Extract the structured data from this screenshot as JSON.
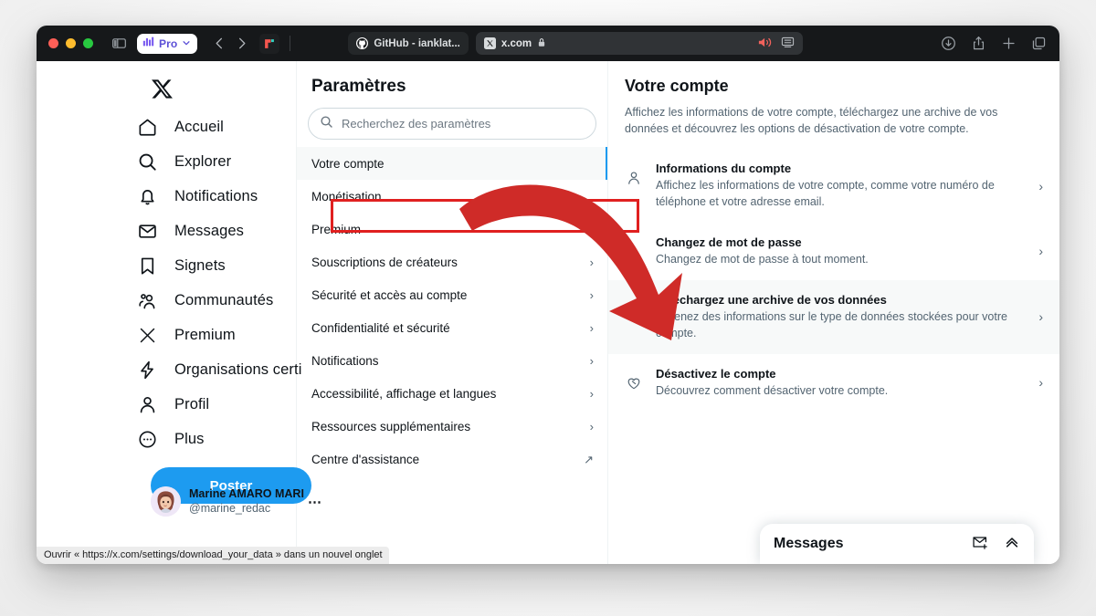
{
  "browser": {
    "traffic_lights": [
      "close",
      "minimize",
      "zoom"
    ],
    "sidebar_toggle_icon": "sidebar-toggle-icon",
    "pro_badge": {
      "label": "Pro",
      "icon": "bar-chart-icon",
      "chevron": "chevron-down-icon",
      "color": "#5b4fd6"
    },
    "nav_back_icon": "chevron-left-icon",
    "nav_forward_icon": "chevron-right-icon",
    "extension_icon": "red-app-icon",
    "tabs": [
      {
        "title": "GitHub - ianklat...",
        "favicon": "github-icon",
        "active": false
      },
      {
        "title": "x.com",
        "favicon": "x-favicon-icon",
        "lock": "lock-icon",
        "active": true,
        "trailing_icons": [
          "audio-playing-icon",
          "picture-in-picture-icon"
        ]
      }
    ],
    "toolbar_right_icons": [
      "downloads-icon",
      "share-icon",
      "new-tab-icon",
      "tab-overview-icon"
    ],
    "titlebar_color": "#16181a"
  },
  "sidebar": {
    "logo": "x-logo-icon",
    "items": [
      {
        "label": "Accueil",
        "icon": "home-icon"
      },
      {
        "label": "Explorer",
        "icon": "search-icon"
      },
      {
        "label": "Notifications",
        "icon": "bell-icon"
      },
      {
        "label": "Messages",
        "icon": "envelope-icon"
      },
      {
        "label": "Signets",
        "icon": "bookmark-icon"
      },
      {
        "label": "Communautés",
        "icon": "communities-icon"
      },
      {
        "label": "Premium",
        "icon": "x-logo-icon"
      },
      {
        "label": "Organisations certi",
        "icon": "lightning-icon"
      },
      {
        "label": "Profil",
        "icon": "person-icon"
      },
      {
        "label": "Plus",
        "icon": "more-circle-icon"
      }
    ],
    "post_button": "Poster",
    "account": {
      "name": "Marine AMARO MARI",
      "handle": "@marine_redac",
      "more_icon": "ellipsis-icon",
      "avatar": "user-avatar"
    },
    "accent_color": "#1d9bf0"
  },
  "settings": {
    "title": "Paramètres",
    "search": {
      "placeholder": "Recherchez des paramètres",
      "value": "",
      "icon": "search-icon"
    },
    "items": [
      {
        "label": "Votre compte",
        "selected": true,
        "trailing": ""
      },
      {
        "label": "Monétisation",
        "selected": false,
        "trailing": ""
      },
      {
        "label": "Premium",
        "selected": false,
        "trailing": ""
      },
      {
        "label": "Souscriptions de créateurs",
        "selected": false,
        "trailing": "chevron"
      },
      {
        "label": "Sécurité et accès au compte",
        "selected": false,
        "trailing": "chevron"
      },
      {
        "label": "Confidentialité et sécurité",
        "selected": false,
        "trailing": "chevron"
      },
      {
        "label": "Notifications",
        "selected": false,
        "trailing": "chevron"
      },
      {
        "label": "Accessibilité, affichage et langues",
        "selected": false,
        "trailing": "chevron"
      },
      {
        "label": "Ressources supplémentaires",
        "selected": false,
        "trailing": "chevron"
      },
      {
        "label": "Centre d'assistance",
        "selected": false,
        "trailing": "external"
      }
    ]
  },
  "detail": {
    "title": "Votre compte",
    "description": "Affichez les informations de votre compte, téléchargez une archive de vos données et découvrez les options de désactivation de votre compte.",
    "rows": [
      {
        "title": "Informations du compte",
        "subtitle": "Affichez les informations de votre compte, comme votre numéro de téléphone et votre adresse email.",
        "icon": "person-icon",
        "highlighted": false
      },
      {
        "title": "Changez de mot de passe",
        "subtitle": "Changez de mot de passe à tout moment.",
        "icon": "key-icon",
        "highlighted": false
      },
      {
        "title": "Téléchargez une archive de vos données",
        "subtitle": "Obtenez des informations sur le type de données stockées pour votre compte.",
        "icon": "download-icon",
        "highlighted": true
      },
      {
        "title": "Désactivez le compte",
        "subtitle": "Découvrez comment désactiver votre compte.",
        "icon": "deactivate-icon",
        "highlighted": false
      }
    ]
  },
  "messages_dock": {
    "title": "Messages",
    "new_message_icon": "new-message-icon",
    "expand_icon": "chevron-up-icon"
  },
  "status_bar": {
    "text": "Ouvrir « https://x.com/settings/download_your_data » dans un nouvel onglet"
  },
  "annotation": {
    "highlight_color": "#e02020",
    "arrow_color": "#cf2b28",
    "arrow_from": "Votre compte",
    "arrow_to": "Téléchargez une archive de vos données"
  }
}
